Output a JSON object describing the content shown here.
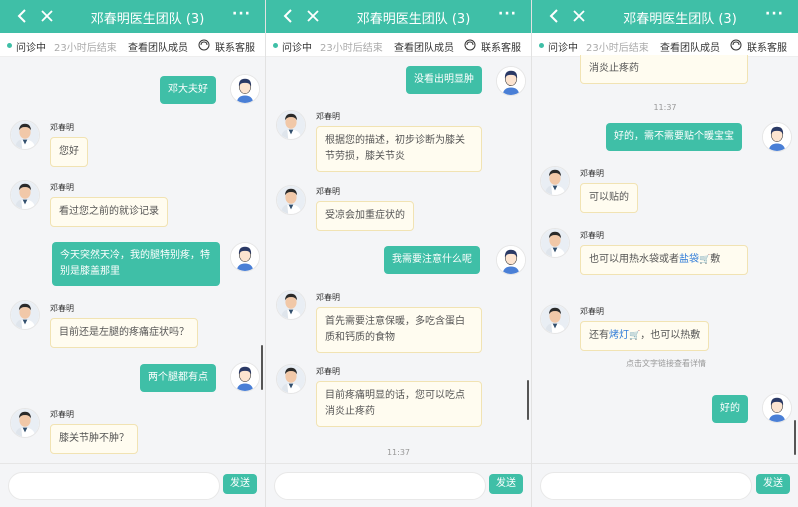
{
  "header": {
    "title": "邓春明医生团队 (3)",
    "more": "···"
  },
  "subbar": {
    "status": "问诊中",
    "remaining": "23小时后结束",
    "team": "查看团队成员",
    "service": "联系客服"
  },
  "input": {
    "send_label": "发送"
  },
  "colors": {
    "accent": "#3fbfa7",
    "doctor_bubble_bg": "#fffcf0",
    "link": "#2f7bd8"
  },
  "panel1": {
    "messages": [
      {
        "from": "patient",
        "text": "邓大夫好"
      },
      {
        "from": "doctor",
        "name": "邓春明",
        "text": "您好"
      },
      {
        "from": "doctor",
        "name": "邓春明",
        "text": "看过您之前的就诊记录"
      },
      {
        "from": "patient",
        "text": "今天突然天冷，我的腿特别疼，特别是膝盖那里"
      },
      {
        "from": "doctor",
        "name": "邓春明",
        "text": "目前还是左腿的疼痛症状吗？"
      },
      {
        "from": "patient",
        "text": "两个腿都有点"
      },
      {
        "from": "doctor",
        "name": "邓春明",
        "text": "膝关节肿不肿？"
      }
    ]
  },
  "panel2": {
    "messages": [
      {
        "from": "patient",
        "text": "没看出明显肿"
      },
      {
        "from": "doctor",
        "name": "邓春明",
        "text": "根据您的描述，初步诊断为膝关节劳损，膝关节炎"
      },
      {
        "from": "doctor",
        "name": "邓春明",
        "text": "受凉会加重症状的"
      },
      {
        "from": "patient",
        "text": "我需要注意什么呢"
      },
      {
        "from": "doctor",
        "name": "邓春明",
        "text": "首先需要注意保暖，多吃含蛋白质和钙质的食物"
      },
      {
        "from": "doctor",
        "name": "邓春明",
        "text": "目前疼痛明显的话，您可以吃点消炎止疼药"
      }
    ],
    "time": "11:37"
  },
  "panel3": {
    "top_fragment": "消炎止疼药",
    "time": "11:37",
    "messages": [
      {
        "from": "patient",
        "text": "好的，需不需要贴个暖宝宝"
      },
      {
        "from": "doctor",
        "name": "邓春明",
        "text": "可以贴的"
      },
      {
        "from": "doctor",
        "name": "邓春明",
        "text_a": "也可以用热水袋或者",
        "link": "盐袋",
        "text_b": "敷"
      },
      {
        "from": "doctor",
        "name": "邓春明",
        "text_a": "还有",
        "link": "烤灯",
        "text_b": "，也可以热敷"
      },
      {
        "from": "patient",
        "text": "好的"
      }
    ],
    "note": "点击文字链接查看详情"
  }
}
